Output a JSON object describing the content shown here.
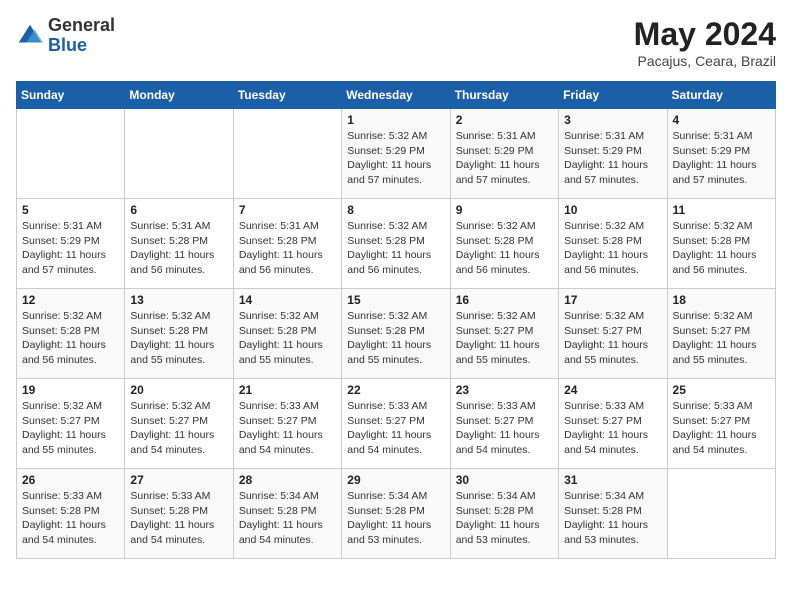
{
  "header": {
    "logo_general": "General",
    "logo_blue": "Blue",
    "month_title": "May 2024",
    "location": "Pacajus, Ceara, Brazil"
  },
  "days_of_week": [
    "Sunday",
    "Monday",
    "Tuesday",
    "Wednesday",
    "Thursday",
    "Friday",
    "Saturday"
  ],
  "weeks": [
    [
      {
        "day": "",
        "content": ""
      },
      {
        "day": "",
        "content": ""
      },
      {
        "day": "",
        "content": ""
      },
      {
        "day": "1",
        "content": "Sunrise: 5:32 AM\nSunset: 5:29 PM\nDaylight: 11 hours\nand 57 minutes."
      },
      {
        "day": "2",
        "content": "Sunrise: 5:31 AM\nSunset: 5:29 PM\nDaylight: 11 hours\nand 57 minutes."
      },
      {
        "day": "3",
        "content": "Sunrise: 5:31 AM\nSunset: 5:29 PM\nDaylight: 11 hours\nand 57 minutes."
      },
      {
        "day": "4",
        "content": "Sunrise: 5:31 AM\nSunset: 5:29 PM\nDaylight: 11 hours\nand 57 minutes."
      }
    ],
    [
      {
        "day": "5",
        "content": "Sunrise: 5:31 AM\nSunset: 5:29 PM\nDaylight: 11 hours\nand 57 minutes."
      },
      {
        "day": "6",
        "content": "Sunrise: 5:31 AM\nSunset: 5:28 PM\nDaylight: 11 hours\nand 56 minutes."
      },
      {
        "day": "7",
        "content": "Sunrise: 5:31 AM\nSunset: 5:28 PM\nDaylight: 11 hours\nand 56 minutes."
      },
      {
        "day": "8",
        "content": "Sunrise: 5:32 AM\nSunset: 5:28 PM\nDaylight: 11 hours\nand 56 minutes."
      },
      {
        "day": "9",
        "content": "Sunrise: 5:32 AM\nSunset: 5:28 PM\nDaylight: 11 hours\nand 56 minutes."
      },
      {
        "day": "10",
        "content": "Sunrise: 5:32 AM\nSunset: 5:28 PM\nDaylight: 11 hours\nand 56 minutes."
      },
      {
        "day": "11",
        "content": "Sunrise: 5:32 AM\nSunset: 5:28 PM\nDaylight: 11 hours\nand 56 minutes."
      }
    ],
    [
      {
        "day": "12",
        "content": "Sunrise: 5:32 AM\nSunset: 5:28 PM\nDaylight: 11 hours\nand 56 minutes."
      },
      {
        "day": "13",
        "content": "Sunrise: 5:32 AM\nSunset: 5:28 PM\nDaylight: 11 hours\nand 55 minutes."
      },
      {
        "day": "14",
        "content": "Sunrise: 5:32 AM\nSunset: 5:28 PM\nDaylight: 11 hours\nand 55 minutes."
      },
      {
        "day": "15",
        "content": "Sunrise: 5:32 AM\nSunset: 5:28 PM\nDaylight: 11 hours\nand 55 minutes."
      },
      {
        "day": "16",
        "content": "Sunrise: 5:32 AM\nSunset: 5:27 PM\nDaylight: 11 hours\nand 55 minutes."
      },
      {
        "day": "17",
        "content": "Sunrise: 5:32 AM\nSunset: 5:27 PM\nDaylight: 11 hours\nand 55 minutes."
      },
      {
        "day": "18",
        "content": "Sunrise: 5:32 AM\nSunset: 5:27 PM\nDaylight: 11 hours\nand 55 minutes."
      }
    ],
    [
      {
        "day": "19",
        "content": "Sunrise: 5:32 AM\nSunset: 5:27 PM\nDaylight: 11 hours\nand 55 minutes."
      },
      {
        "day": "20",
        "content": "Sunrise: 5:32 AM\nSunset: 5:27 PM\nDaylight: 11 hours\nand 54 minutes."
      },
      {
        "day": "21",
        "content": "Sunrise: 5:33 AM\nSunset: 5:27 PM\nDaylight: 11 hours\nand 54 minutes."
      },
      {
        "day": "22",
        "content": "Sunrise: 5:33 AM\nSunset: 5:27 PM\nDaylight: 11 hours\nand 54 minutes."
      },
      {
        "day": "23",
        "content": "Sunrise: 5:33 AM\nSunset: 5:27 PM\nDaylight: 11 hours\nand 54 minutes."
      },
      {
        "day": "24",
        "content": "Sunrise: 5:33 AM\nSunset: 5:27 PM\nDaylight: 11 hours\nand 54 minutes."
      },
      {
        "day": "25",
        "content": "Sunrise: 5:33 AM\nSunset: 5:27 PM\nDaylight: 11 hours\nand 54 minutes."
      }
    ],
    [
      {
        "day": "26",
        "content": "Sunrise: 5:33 AM\nSunset: 5:28 PM\nDaylight: 11 hours\nand 54 minutes."
      },
      {
        "day": "27",
        "content": "Sunrise: 5:33 AM\nSunset: 5:28 PM\nDaylight: 11 hours\nand 54 minutes."
      },
      {
        "day": "28",
        "content": "Sunrise: 5:34 AM\nSunset: 5:28 PM\nDaylight: 11 hours\nand 54 minutes."
      },
      {
        "day": "29",
        "content": "Sunrise: 5:34 AM\nSunset: 5:28 PM\nDaylight: 11 hours\nand 53 minutes."
      },
      {
        "day": "30",
        "content": "Sunrise: 5:34 AM\nSunset: 5:28 PM\nDaylight: 11 hours\nand 53 minutes."
      },
      {
        "day": "31",
        "content": "Sunrise: 5:34 AM\nSunset: 5:28 PM\nDaylight: 11 hours\nand 53 minutes."
      },
      {
        "day": "",
        "content": ""
      }
    ]
  ]
}
